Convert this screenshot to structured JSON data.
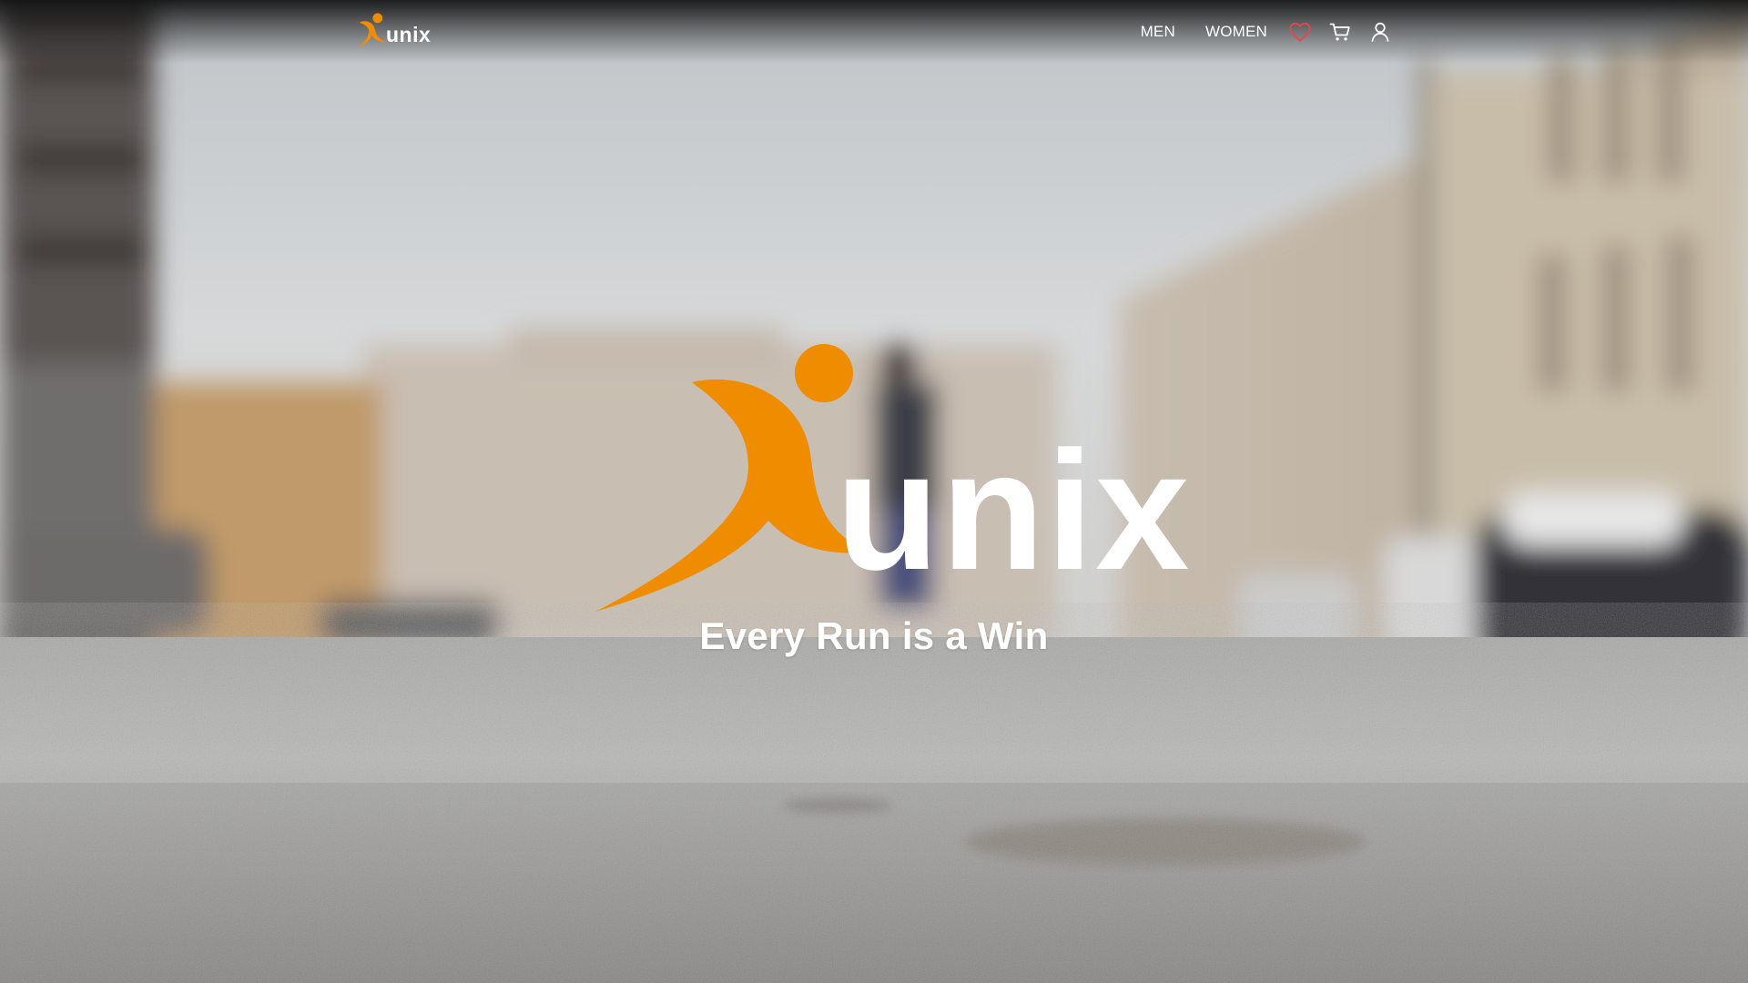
{
  "brand": {
    "name": "unix",
    "accent_color": "#f08c00",
    "logo_icon": "running-figure-logo-icon"
  },
  "nav": {
    "links": [
      {
        "label": "MEN"
      },
      {
        "label": "WOMEN"
      }
    ],
    "icons": {
      "wishlist": "heart-icon",
      "cart": "cart-icon",
      "account": "user-icon"
    },
    "wishlist_color": "#e5484d"
  },
  "hero": {
    "brand_word": "unix",
    "tagline": "Every Run is a Win",
    "background": "blurred-city-street-photo"
  }
}
